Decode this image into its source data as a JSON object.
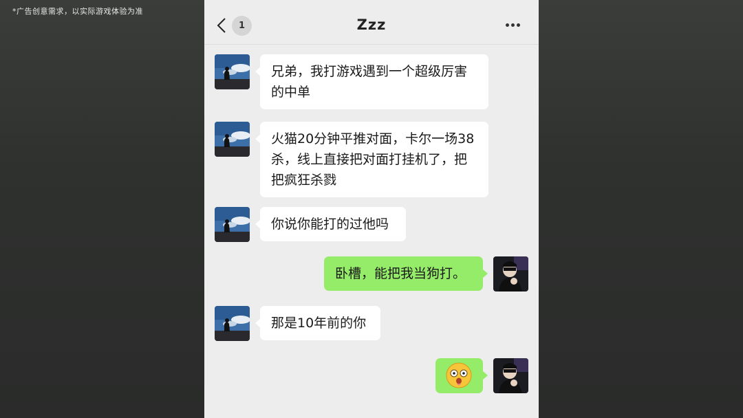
{
  "disclaimer": "*广告创意需求，以实际游戏体验为准",
  "header": {
    "back_icon": "chevron-left-icon",
    "unread_count": "1",
    "title": "Zzz",
    "more_icon": "ellipsis-icon"
  },
  "messages": [
    {
      "side": "in",
      "text": "兄弟，我打游戏遇到一个超级厉害的中单"
    },
    {
      "side": "in",
      "text": "火猫20分钟平推对面，卡尔一场38杀，线上直接把对面打挂机了，把把疯狂杀戮"
    },
    {
      "side": "in",
      "text": "你说你能打的过他吗"
    },
    {
      "side": "out",
      "text": "卧槽，能把我当狗打。"
    },
    {
      "side": "in",
      "text": "那是10年前的你"
    },
    {
      "side": "out",
      "sticker": "shocked-face-emoji"
    }
  ],
  "colors": {
    "incoming_bubble": "#ffffff",
    "outgoing_bubble": "#95ec69",
    "chat_background": "#ededed"
  }
}
